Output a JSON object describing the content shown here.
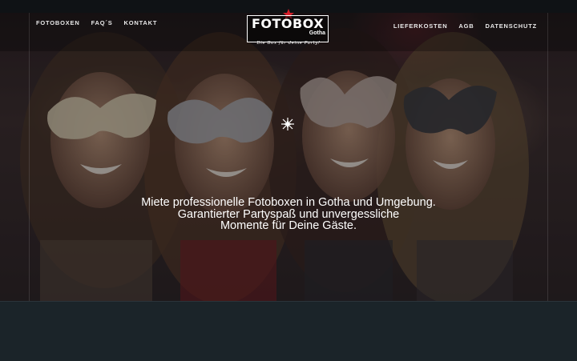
{
  "nav": {
    "left": [
      "FOTOBOXEN",
      "FAQ´S",
      "KONTAKT"
    ],
    "right": [
      "LIEFERKOSTEN",
      "AGB",
      "DATENSCHUTZ"
    ]
  },
  "logo": {
    "main": "FOTOBOX",
    "sub": "Gotha",
    "tagline": "Die Box für deine Party!",
    "star_icon": "star-icon"
  },
  "hero": {
    "line1": "Miete professionelle Fotoboxen in Gotha und Umgebung.",
    "line2": "Garantierter Partyspaß und unvergessliche",
    "line3": "Momente für Deine Gäste.",
    "center_icon": "sparkle-icon"
  },
  "colors": {
    "text": "#ffffff",
    "background": "#1b2429",
    "accent": "#d81e2a"
  }
}
